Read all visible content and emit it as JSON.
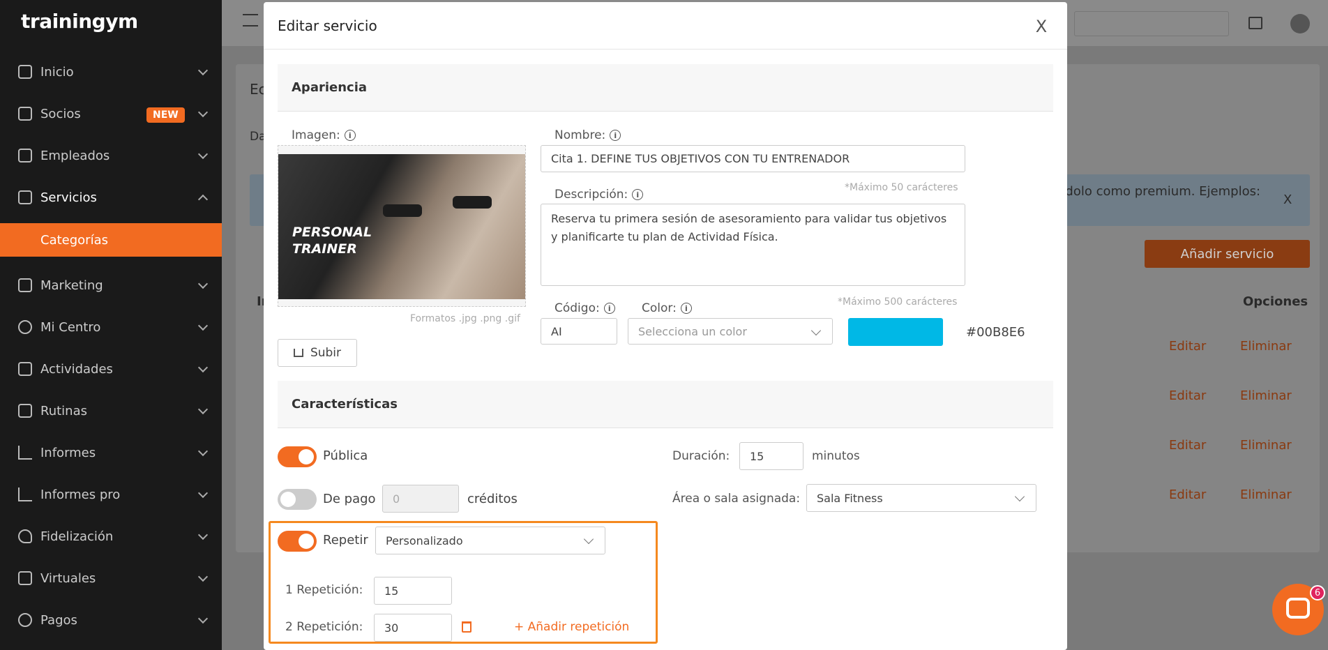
{
  "app": {
    "logo": "trainingym"
  },
  "sidebar": {
    "items": [
      {
        "label": "Inicio"
      },
      {
        "label": "Socios",
        "badge": "NEW"
      },
      {
        "label": "Empleados"
      },
      {
        "label": "Servicios"
      },
      {
        "label": "Marketing"
      },
      {
        "label": "Mi Centro"
      },
      {
        "label": "Actividades"
      },
      {
        "label": "Rutinas"
      },
      {
        "label": "Informes"
      },
      {
        "label": "Informes pro"
      },
      {
        "label": "Fidelización"
      },
      {
        "label": "Virtuales"
      },
      {
        "label": "Pagos"
      }
    ],
    "subitem": "Categorías"
  },
  "background": {
    "page_title": "Ec",
    "tab_fragment": "Da",
    "notice_fragment": "ndolo como premium. Ejemplos:",
    "add_button": "Añadir servicio",
    "options_header": "Opciones",
    "col_fragment": "Ir",
    "edit": "Editar",
    "delete": "Eliminar",
    "close_x": "X"
  },
  "modal": {
    "title": "Editar servicio",
    "close": "X",
    "appearance": {
      "heading": "Apariencia",
      "image_label": "Imagen:",
      "image_text": "PERSONAL TRAINER",
      "formats_hint": "Formatos .jpg .png .gif",
      "upload_button": "Subir",
      "name_label": "Nombre:",
      "name_value": "Cita 1. DEFINE TUS OBJETIVOS CON TU ENTRENADOR",
      "name_hint": "*Máximo 50 carácteres",
      "description_label": "Descripción:",
      "description_value": "Reserva tu primera sesión de asesoramiento para validar tus objetivos y planificarte tu plan de Actividad Física.",
      "description_hint": "*Máximo 500 carácteres",
      "code_label": "Código:",
      "code_value": "AI",
      "color_label": "Color:",
      "color_placeholder": "Selecciona un color",
      "color_hex": "#00B8E6",
      "info_glyph": "i"
    },
    "characteristics": {
      "heading": "Características",
      "public_label": "Pública",
      "public_on": true,
      "paid_label": "De pago",
      "paid_on": false,
      "credits_placeholder": "0",
      "credits_label": "créditos",
      "repeat_label": "Repetir",
      "repeat_on": true,
      "repeat_mode": "Personalizado",
      "repetitions": [
        {
          "label": "1 Repetición:",
          "value": "15"
        },
        {
          "label": "2 Repetición:",
          "value": "30"
        }
      ],
      "add_repetition": "+ Añadir repetición",
      "duration_label": "Duración:",
      "duration_value": "15",
      "duration_unit": "minutos",
      "room_label": "Área o sala asignada:",
      "room_value": "Sala Fitness"
    }
  },
  "chat": {
    "badge": "6"
  }
}
